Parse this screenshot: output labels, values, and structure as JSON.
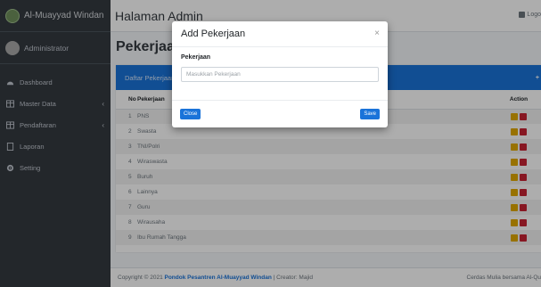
{
  "brand": {
    "name": "Al-Muayyad Windan"
  },
  "user": {
    "name": "Administrator"
  },
  "sidebar": {
    "items": [
      {
        "label": "Dashboard",
        "icon": "dashboard-icon",
        "has_chevron": false
      },
      {
        "label": "Master Data",
        "icon": "table-icon",
        "has_chevron": true
      },
      {
        "label": "Pendaftaran",
        "icon": "table-icon",
        "has_chevron": true
      },
      {
        "label": "Laporan",
        "icon": "copy-icon",
        "has_chevron": false
      },
      {
        "label": "Setting",
        "icon": "gear-icon",
        "has_chevron": false
      }
    ]
  },
  "navbar": {
    "title": "Halaman Admin",
    "logout": "Logo"
  },
  "page": {
    "title": "Pekerjaan"
  },
  "card": {
    "title": "Daftar Pekerjaan",
    "add_label": "+"
  },
  "table": {
    "headers": {
      "no": "No",
      "name": "Pekerjaan",
      "action": "Action"
    },
    "rows": [
      {
        "no": "1",
        "name": "PNS"
      },
      {
        "no": "2",
        "name": "Swasta"
      },
      {
        "no": "3",
        "name": "TNI/Polri"
      },
      {
        "no": "4",
        "name": "Wiraswasta"
      },
      {
        "no": "5",
        "name": "Buruh"
      },
      {
        "no": "6",
        "name": "Lainnya"
      },
      {
        "no": "7",
        "name": "Guru"
      },
      {
        "no": "8",
        "name": "Wirausaha"
      },
      {
        "no": "9",
        "name": "Ibu Rumah Tangga"
      }
    ]
  },
  "footer": {
    "prefix": "Copyright © 2021",
    "org": "Pondok Pesantren Al-Muayyad Windan",
    "creator": "| Creator: Majid",
    "right": "Cerdas Mulia bersama Al-Qu"
  },
  "modal": {
    "title": "Add Pekerjaan",
    "close_glyph": "×",
    "field_label": "Pekerjaan",
    "field_placeholder": "Masukkan Pekerjaan",
    "field_value": "",
    "close_button": "Close",
    "save_button": "Save"
  },
  "colors": {
    "sidebar_bg": "#343a40",
    "primary": "#1a73d9",
    "edit": "#e0a800",
    "delete": "#c82333"
  }
}
